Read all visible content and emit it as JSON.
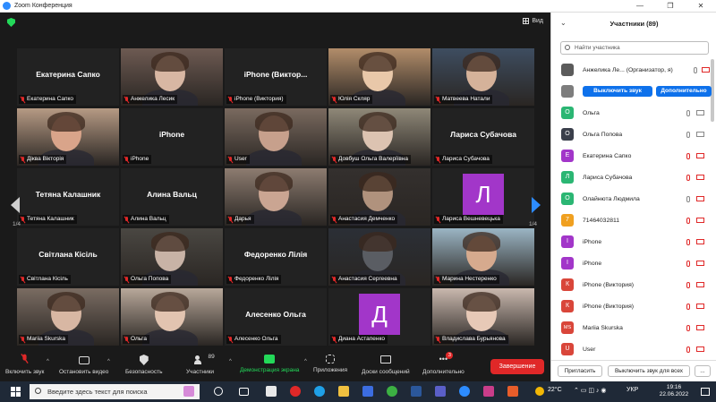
{
  "window": {
    "title": "Zoom Конференция",
    "controls": [
      "—",
      "❐",
      "✕"
    ]
  },
  "video": {
    "view_label": "Вид",
    "page_left": "1/4",
    "page_right": "1/4",
    "tiles": [
      {
        "label": "Екатерина Сапко",
        "center": "Екатерина Сапко",
        "kind": "name"
      },
      {
        "label": "Анжелика Лесик",
        "center": "",
        "kind": "photo",
        "bg": "#6d5a52",
        "face": "#d8b7a3"
      },
      {
        "label": "iPhone (Виктория)",
        "center": "iPhone  (Виктор...",
        "kind": "name"
      },
      {
        "label": "Юлія Скляр",
        "center": "",
        "kind": "photo",
        "bg": "#b28d6a",
        "face": "#e9c8a9"
      },
      {
        "label": "Матвеева Натали",
        "center": "",
        "kind": "photo",
        "bg": "#3e4d60",
        "face": "#d5b29a"
      },
      {
        "label": "Діква Вікторія",
        "center": "",
        "kind": "photo",
        "bg": "#b69a84",
        "face": "#d9a48a"
      },
      {
        "label": "iPhone",
        "center": "iPhone",
        "kind": "name"
      },
      {
        "label": "User",
        "center": "",
        "kind": "photo",
        "bg": "#7a6a5f",
        "face": "#c7a08c"
      },
      {
        "label": "Довбуш Ольга Валеріївна",
        "center": "",
        "kind": "photo",
        "bg": "#8f8878",
        "face": "#dcc3b1"
      },
      {
        "label": "Лариса Субачова",
        "center": "Лариса Субачова",
        "kind": "name"
      },
      {
        "label": "Тетяна Калашник",
        "center": "Тетяна Калашник",
        "kind": "name"
      },
      {
        "label": "Алина Вальц",
        "center": "Алина Вальц",
        "kind": "name"
      },
      {
        "label": "Дарья",
        "center": "",
        "kind": "photo",
        "bg": "#8d7c70",
        "face": "#caa592"
      },
      {
        "label": "Анастасия Демченко",
        "center": "",
        "kind": "photo",
        "bg": "#34302e",
        "face": "#b0927d"
      },
      {
        "label": "Лариса Вешневецька",
        "center": "",
        "kind": "letter",
        "letter": "Л",
        "lcolor": "#a236c9"
      },
      {
        "label": "Світлана Кісіль",
        "center": "Світлана Кісіль",
        "kind": "name"
      },
      {
        "label": "Ольга Попова",
        "center": "",
        "kind": "photo",
        "bg": "#4a4742",
        "face": "#c8b3a6",
        "active": true
      },
      {
        "label": "Федоренко Лілія",
        "center": "Федоренко Лілія",
        "kind": "name"
      },
      {
        "label": "Анастасия Сергеевна",
        "center": "",
        "kind": "photo",
        "bg": "#2b2f36",
        "face": "#5a5d63"
      },
      {
        "label": "Марина Нестеренко",
        "center": "",
        "kind": "photo",
        "bg": "#9bb5c4",
        "face": "#d6aa8e"
      },
      {
        "label": "Mariia Skurska",
        "center": "",
        "kind": "photo",
        "bg": "#7a6c62",
        "face": "#d8b7a3"
      },
      {
        "label": "Ольга",
        "center": "",
        "kind": "photo",
        "bg": "#b8a89a",
        "face": "#e2c4b0"
      },
      {
        "label": "Алесенко Ольга",
        "center": "Алесенко Ольга",
        "kind": "name"
      },
      {
        "label": "Диана Астапенко",
        "center": "",
        "kind": "letter",
        "letter": "Д",
        "lcolor": "#a236c9"
      },
      {
        "label": "Владислава Бурьянова",
        "center": "",
        "kind": "photo",
        "bg": "#c9b8ae",
        "face": "#e7c9b7"
      }
    ]
  },
  "toolbar": {
    "mute": "Включить звук",
    "video": "Остановить видео",
    "security": "Безопасность",
    "participants": "Участники",
    "participants_count": "89",
    "share": "Демонстрация экрана",
    "apps": "Приложения",
    "whiteboards": "Доски сообщений",
    "more": "Дополнительно",
    "more_badge": "3",
    "end": "Завершение"
  },
  "panel": {
    "title": "Участники (89)",
    "search_placeholder": "Найти участника",
    "host_name": "Анжелика Ле... (Организатор, я)",
    "unmute_btn": "Выключить звук",
    "more_btn": "Дополнительно",
    "participants": [
      {
        "name": "Ольга",
        "initial": "О",
        "color": "#2bb673",
        "mic": "on",
        "cam": "on"
      },
      {
        "name": "Ольга Попова",
        "initial": "О",
        "color": "#3a3f4b",
        "mic": "on",
        "cam": "on"
      },
      {
        "name": "Екатерина Сапко",
        "initial": "Е",
        "color": "#a236c9",
        "mic": "off",
        "cam": "off"
      },
      {
        "name": "Лариса Субачова",
        "initial": "Л",
        "color": "#2bb673",
        "mic": "off",
        "cam": "off"
      },
      {
        "name": "Олайнюта Людмила",
        "initial": "О",
        "color": "#2bb673",
        "mic": "on",
        "cam": "off"
      },
      {
        "name": "71464032811",
        "initial": "7",
        "color": "#f0a020",
        "mic": "off",
        "cam": "off"
      },
      {
        "name": "iPhone",
        "initial": "I",
        "color": "#a236c9",
        "mic": "off",
        "cam": "off"
      },
      {
        "name": "iPhone",
        "initial": "I",
        "color": "#a236c9",
        "mic": "off",
        "cam": "off"
      },
      {
        "name": "iPhone (Виктория)",
        "initial": "К",
        "color": "#d9463a",
        "mic": "off",
        "cam": "off"
      },
      {
        "name": "iPhone (Виктория)",
        "initial": "К",
        "color": "#d9463a",
        "mic": "off",
        "cam": "off"
      },
      {
        "name": "Mariia Skurska",
        "initial": "MS",
        "color": "#d9463a",
        "mic": "off",
        "cam": "off"
      },
      {
        "name": "User",
        "initial": "U",
        "color": "#d9463a",
        "mic": "off",
        "cam": "off"
      }
    ],
    "invite_btn": "Пригласить",
    "mute_all_btn": "Выключить звук для всех",
    "more_footer": "..."
  },
  "taskbar": {
    "search_placeholder": "Введите здесь текст для поиска",
    "temperature": "22°C",
    "lang": "УКР",
    "time": "19:16",
    "date": "22.06.2022"
  }
}
